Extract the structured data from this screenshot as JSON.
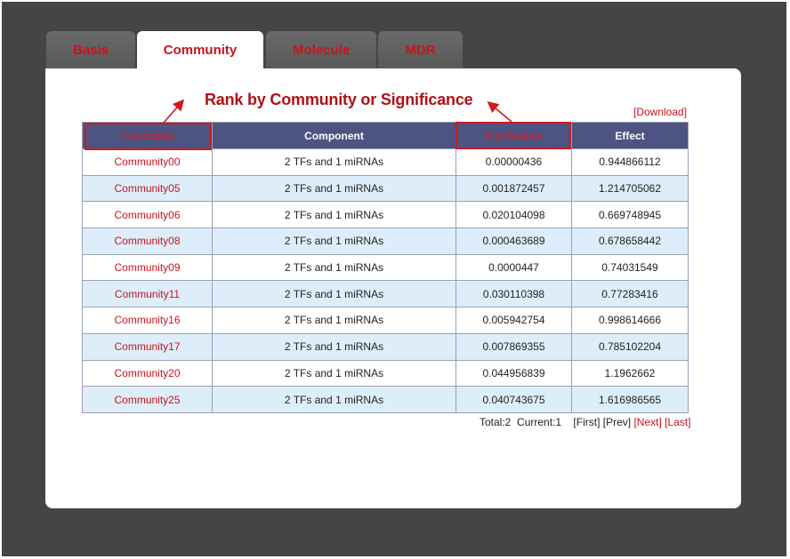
{
  "tabs": [
    {
      "label": "Basis",
      "active": false
    },
    {
      "label": "Community",
      "active": true
    },
    {
      "label": "Molecule",
      "active": false
    },
    {
      "label": "MDR",
      "active": false
    }
  ],
  "annotation": "Rank by Community or Significance",
  "download_label": "[Download]",
  "table": {
    "headers": [
      "Community",
      "Component",
      "Significance",
      "Effect"
    ],
    "rows": [
      [
        "Community00",
        "2 TFs and 1 miRNAs",
        "0.00000436",
        "0.944866112"
      ],
      [
        "Community05",
        "2 TFs and 1 miRNAs",
        "0.001872457",
        "1.214705062"
      ],
      [
        "Community06",
        "2 TFs and 1 miRNAs",
        "0.020104098",
        "0.669748945"
      ],
      [
        "Community08",
        "2 TFs and 1 miRNAs",
        "0.000463689",
        "0.678658442"
      ],
      [
        "Community09",
        "2 TFs and 1 miRNAs",
        "0.0000447",
        "0.74031549"
      ],
      [
        "Community11",
        "2 TFs and 1 miRNAs",
        "0.030110398",
        "0.77283416"
      ],
      [
        "Community16",
        "2 TFs and 1 miRNAs",
        "0.005942754",
        "0.998614666"
      ],
      [
        "Community17",
        "2 TFs and 1 miRNAs",
        "0.007869355",
        "0.785102204"
      ],
      [
        "Community20",
        "2 TFs and 1 miRNAs",
        "0.044956839",
        "1.1962662"
      ],
      [
        "Community25",
        "2 TFs and 1 miRNAs",
        "0.040743675",
        "1.616986565"
      ]
    ]
  },
  "pager": {
    "total": "Total:2",
    "current": "Current:1",
    "first": "[First]",
    "prev": "[Prev]",
    "next": "[Next]",
    "last": "[Last]"
  },
  "colors": {
    "accent": "#c8141e",
    "header_bg": "#4e5481",
    "alt_row": "#ddeefa"
  }
}
